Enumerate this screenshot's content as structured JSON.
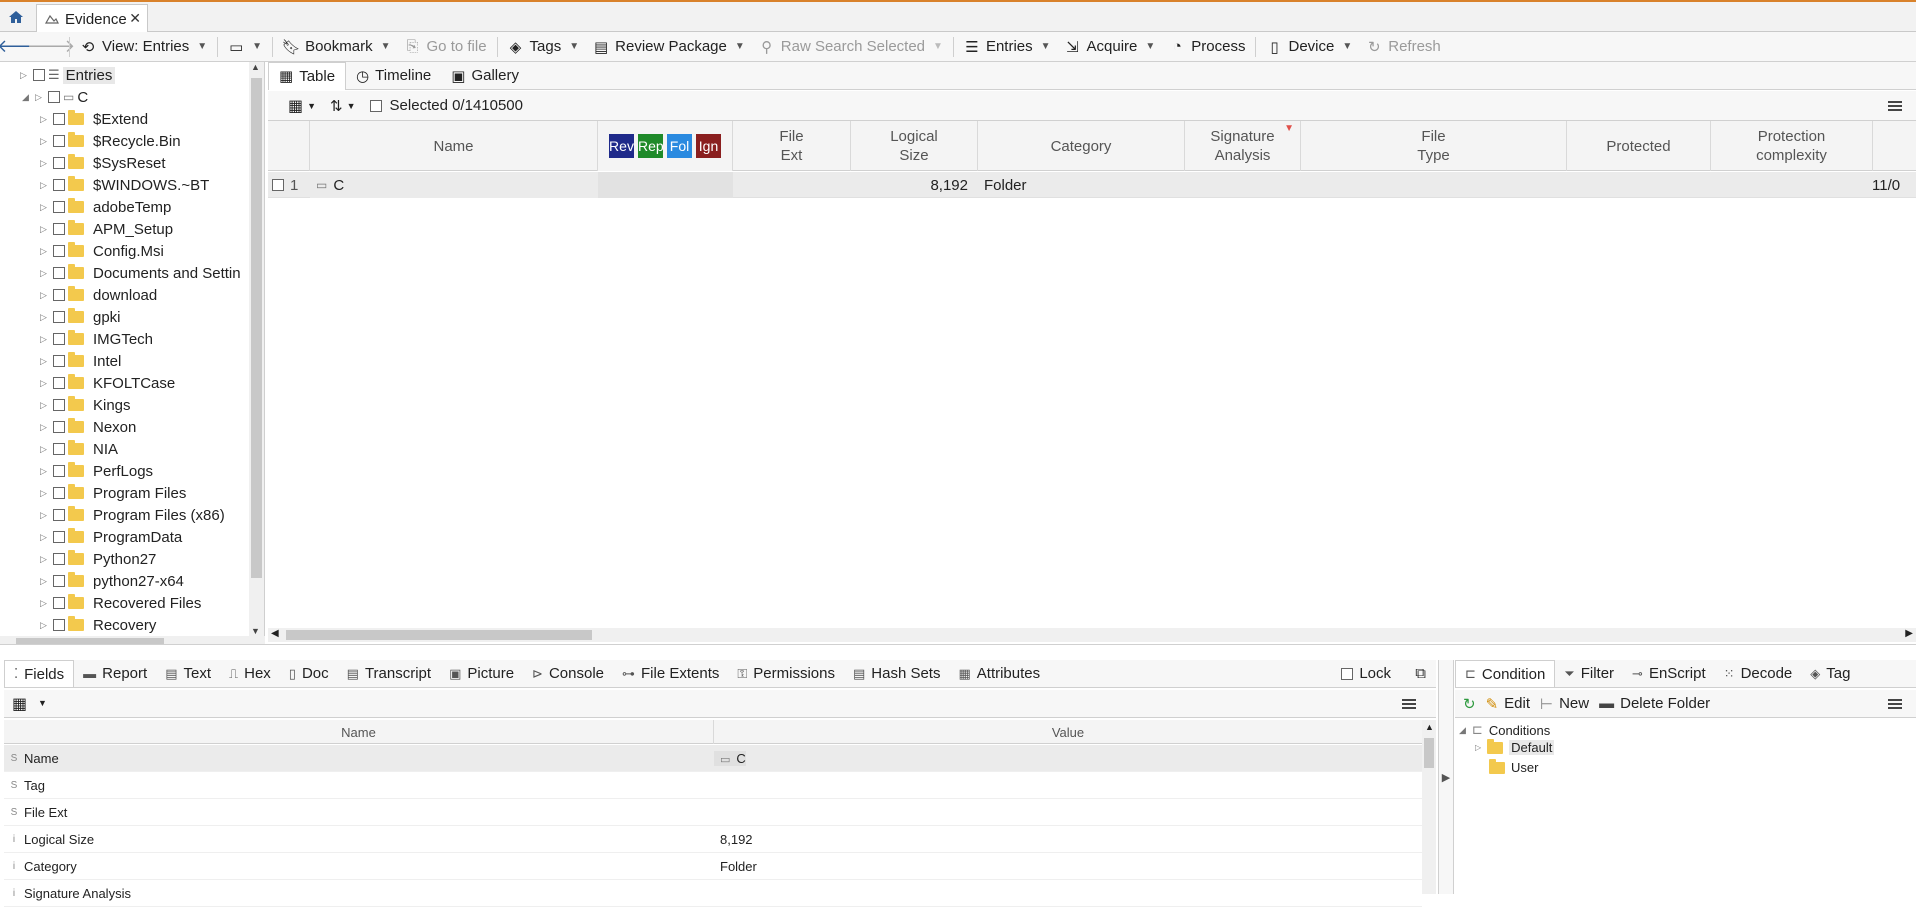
{
  "tabs": {
    "doc_tab_label": "Evidence"
  },
  "toolbar": {
    "view_label": "View: Entries",
    "bookmark": "Bookmark",
    "go_to_file": "Go to file",
    "tags": "Tags",
    "review_package": "Review Package",
    "raw_search_selected": "Raw Search Selected",
    "entries": "Entries",
    "acquire": "Acquire",
    "process": "Process",
    "device": "Device",
    "refresh": "Refresh"
  },
  "tree": {
    "root_label": "Entries",
    "drive_label": "C",
    "items": [
      "$Extend",
      "$Recycle.Bin",
      "$SysReset",
      "$WINDOWS.~BT",
      "adobeTemp",
      "APM_Setup",
      "Config.Msi",
      "Documents and Settin",
      "download",
      "gpki",
      "IMGTech",
      "Intel",
      "KFOLTCase",
      "Kings",
      "Nexon",
      "NIA",
      "PerfLogs",
      "Program Files",
      "Program Files (x86)",
      "ProgramData",
      "Python27",
      "python27-x64",
      "Recovered Files",
      "Recovery"
    ]
  },
  "view_tabs": {
    "table": "Table",
    "timeline": "Timeline",
    "gallery": "Gallery"
  },
  "grid": {
    "selected_text": "Selected 0/1410500",
    "columns": {
      "name": "Name",
      "tag_rev": "Rev",
      "tag_rep": "Rep",
      "tag_fol": "Fol",
      "tag_ign": "Ign",
      "file_ext_1": "File",
      "file_ext_2": "Ext",
      "logical_size_1": "Logical",
      "logical_size_2": "Size",
      "category": "Category",
      "signature_1": "Signature",
      "signature_2": "Analysis",
      "file_type_1": "File",
      "file_type_2": "Type",
      "protected": "Protected",
      "protection_1": "Protection",
      "protection_2": "complexity"
    },
    "row": {
      "index": "1",
      "name": "C",
      "logical_size": "8,192",
      "category": "Folder",
      "date": "11/0"
    },
    "tag_colors": {
      "rev": "#1f2a8a",
      "rep": "#1f8a2a",
      "fol": "#2a8ae0",
      "ign": "#8a1f1f"
    }
  },
  "detail_tabs": [
    "Fields",
    "Report",
    "Text",
    "Hex",
    "Doc",
    "Transcript",
    "Picture",
    "Console",
    "File Extents",
    "Permissions",
    "Hash Sets",
    "Attributes"
  ],
  "lock_label": "Lock",
  "fields": {
    "head_name": "Name",
    "head_value": "Value",
    "rows": [
      {
        "kind": "S",
        "name": "Name",
        "value": "C"
      },
      {
        "kind": "S",
        "name": "Tag",
        "value": ""
      },
      {
        "kind": "S",
        "name": "File Ext",
        "value": ""
      },
      {
        "kind": "i",
        "name": "Logical Size",
        "value": "8,192"
      },
      {
        "kind": "i",
        "name": "Category",
        "value": "Folder"
      },
      {
        "kind": "i",
        "name": "Signature Analysis",
        "value": ""
      }
    ]
  },
  "conditions": {
    "tabs": [
      "Condition",
      "Filter",
      "EnScript",
      "Decode",
      "Tag"
    ],
    "edit": "Edit",
    "new": "New",
    "delete_folder": "Delete Folder",
    "root": "Conditions",
    "children": [
      "Default",
      "User"
    ]
  }
}
